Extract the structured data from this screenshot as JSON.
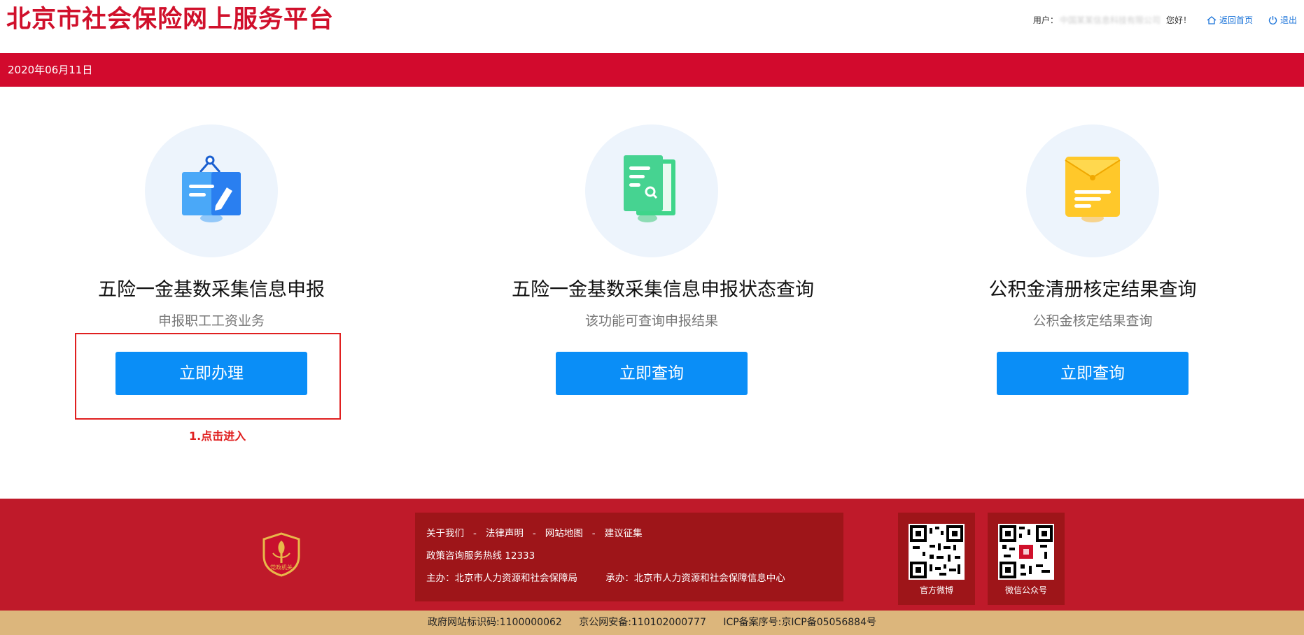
{
  "header": {
    "site_title": "北京市社会保险网上服务平台",
    "user_label": "用户：",
    "user_name": "中国某某信息科技有限公司",
    "greeting": "您好！",
    "home_link": "返回首页",
    "logout_link": "退出"
  },
  "datebar": {
    "date": "2020年06月11日"
  },
  "cards": [
    {
      "title": "五险一金基数采集信息申报",
      "subtitle": "申报职工工资业务",
      "button": "立即办理",
      "icon": "clipboard-edit-icon"
    },
    {
      "title": "五险一金基数采集信息申报状态查询",
      "subtitle": "该功能可查询申报结果",
      "button": "立即查询",
      "icon": "document-search-icon"
    },
    {
      "title": "公积金清册核定结果查询",
      "subtitle": "公积金核定结果查询",
      "button": "立即查询",
      "icon": "envelope-doc-icon"
    }
  ],
  "annotation": {
    "text": "1.点击进入"
  },
  "footer": {
    "emblem_text": "党政机关",
    "links": [
      "关于我们",
      "法律声明",
      "网站地图",
      "建议征集"
    ],
    "link_separator": "-",
    "hotline": "政策咨询服务热线 12333",
    "sponsor": "主办：北京市人力资源和社会保障局",
    "organizer": "承办：北京市人力资源和社会保障信息中心",
    "qr_weibo": "官方微博",
    "qr_wechat": "微信公众号"
  },
  "strip": {
    "gov_id": "政府网站标识码:1100000062",
    "police_id": "京公网安备:110102000777",
    "icp": "ICP备案序号:京ICP备05056884号"
  },
  "colors": {
    "brand_red": "#d20a2d",
    "button_blue": "#0a8ef7",
    "footer_red": "#bf1a2a",
    "strip_tan": "#dcb67c"
  }
}
